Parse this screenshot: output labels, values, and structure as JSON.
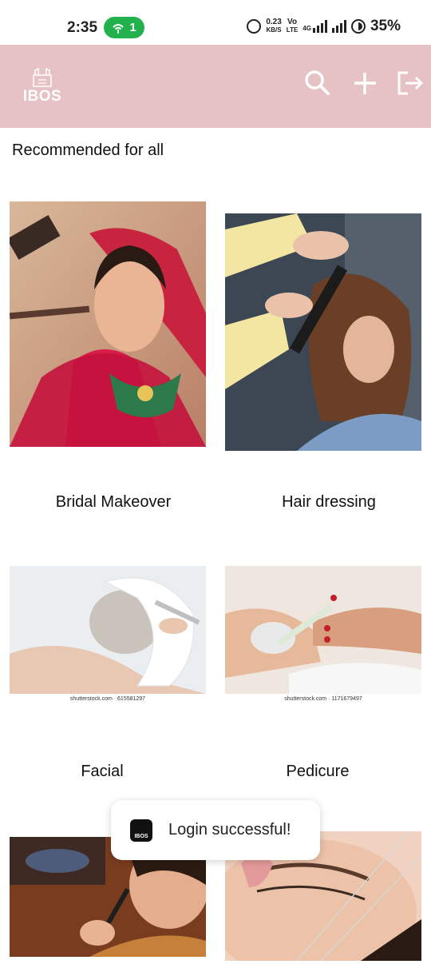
{
  "status_bar": {
    "time": "2:35",
    "hotspot_count": "1",
    "net_speed_top": "0.23",
    "net_speed_bottom": "KB/S",
    "volte_top": "Vo",
    "volte_bottom": "LTE",
    "network": "4G",
    "battery": "35%"
  },
  "app_bar": {
    "logo_text": "IBOS",
    "background": "#e6c2c4",
    "icons": [
      "search-icon",
      "add-icon",
      "logout-icon"
    ]
  },
  "section": {
    "title": "Recommended for all"
  },
  "services": [
    {
      "label": "Bridal Makeover"
    },
    {
      "label": "Hair dressing"
    },
    {
      "label": "Facial",
      "watermark": "shutterstock.com · 615581297"
    },
    {
      "label": "Pedicure",
      "watermark": "shutterstock.com · 1171679497"
    },
    {
      "label": ""
    },
    {
      "label": ""
    }
  ],
  "toast": {
    "message": "Login successful!",
    "icon_text": "IBOS"
  }
}
